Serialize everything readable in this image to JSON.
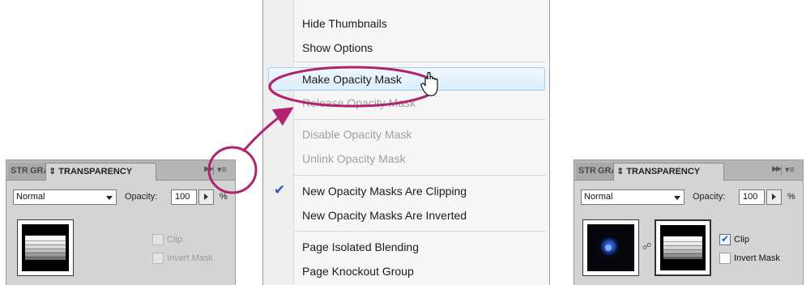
{
  "left_panel": {
    "tabs": [
      "STR",
      "GRA",
      "TRANSPARENCY"
    ],
    "blend_mode": "Normal",
    "opacity_label": "Opacity:",
    "opacity_value": "100",
    "opacity_unit": "%",
    "clip_label": "Clip",
    "clip_checked": false,
    "invert_label": "Invert Mask",
    "invert_checked": false
  },
  "right_panel": {
    "tabs": [
      "STR",
      "GRA",
      "TRANSPARENCY"
    ],
    "blend_mode": "Normal",
    "opacity_label": "Opacity:",
    "opacity_value": "100",
    "opacity_unit": "%",
    "clip_label": "Clip",
    "clip_checked": true,
    "invert_label": "Invert Mask",
    "invert_checked": false
  },
  "menu": {
    "items": [
      {
        "label": "Hide Thumbnails",
        "enabled": true
      },
      {
        "label": "Show Options",
        "enabled": true
      },
      {
        "label": "Make Opacity Mask",
        "enabled": true,
        "highlighted": true
      },
      {
        "label": "Release Opacity Mask",
        "enabled": false
      },
      {
        "label": "Disable Opacity Mask",
        "enabled": false
      },
      {
        "label": "Unlink Opacity Mask",
        "enabled": false
      },
      {
        "label": "New Opacity Masks Are Clipping",
        "enabled": true,
        "checked": true
      },
      {
        "label": "New Opacity Masks Are Inverted",
        "enabled": true
      },
      {
        "label": "Page Isolated Blending",
        "enabled": true
      },
      {
        "label": "Page Knockout Group",
        "enabled": true
      }
    ]
  },
  "colors": {
    "annotation": "#b0226e",
    "highlight_border": "#a8cfe7",
    "check": "#2a5cc0"
  }
}
